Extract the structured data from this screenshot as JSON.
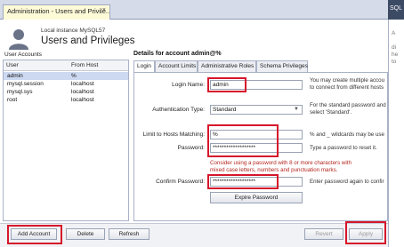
{
  "window": {
    "doc_tab_label": "Administration - Users and Privile...",
    "close_glyph": "×",
    "side_tab_label": "SQL"
  },
  "header": {
    "host_label": "Local instance MySQL57",
    "title": "Users and Privileges"
  },
  "user_accounts": {
    "label": "User Accounts",
    "columns": [
      "User",
      "From Host"
    ],
    "rows": [
      {
        "user": "admin",
        "host": "%"
      },
      {
        "user": "mysql.session",
        "host": "localhost"
      },
      {
        "user": "mysql.sys",
        "host": "localhost"
      },
      {
        "user": "root",
        "host": "localhost"
      }
    ],
    "selected_index": 0
  },
  "details": {
    "title": "Details for account admin@%",
    "tabs": [
      "Login",
      "Account Limits",
      "Administrative Roles",
      "Schema Privileges"
    ],
    "active_tab": 0,
    "login_name_label": "Login Name:",
    "login_name_value": "admin",
    "login_name_note_1": "You may create multiple accou",
    "login_name_note_2": "to connect from different hosts",
    "auth_type_label": "Authentication Type:",
    "auth_type_value": "Standard",
    "auth_note_1": "For the standard password and",
    "auth_note_2": "select 'Standard'.",
    "hosts_label": "Limit to Hosts Matching:",
    "hosts_value": "%",
    "hosts_note": "% and _ wildcards may be use",
    "password_label": "Password:",
    "password_value": "*******************",
    "password_note": "Type a password to reset it.",
    "warning_1": "Consider using a password with 8 or more characters with",
    "warning_2": "mixed case letters, numbers and punctuation marks.",
    "confirm_label": "Confirm Password:",
    "confirm_value": "*******************",
    "confirm_note": "Enter password again to confir",
    "expire_button": "Expire Password"
  },
  "bottom": {
    "add_account": "Add Account",
    "delete": "Delete",
    "refresh": "Refresh",
    "revert": "Revert",
    "apply": "Apply"
  },
  "right_panel": {
    "lines": [
      "A",
      "di",
      "he",
      "to"
    ]
  },
  "colors": {
    "highlight": "#d6162b",
    "selected_row": "#ccd9f0",
    "warning_text": "#b3261e"
  }
}
